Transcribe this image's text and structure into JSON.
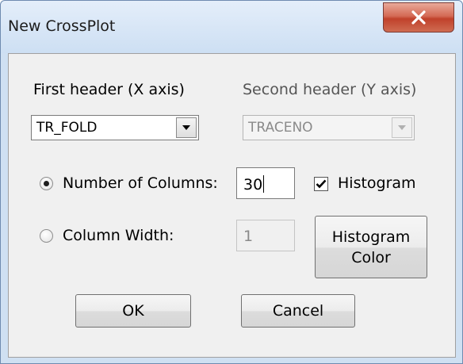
{
  "window": {
    "title": "New CrossPlot",
    "close_icon": "close-x-icon"
  },
  "x_header": {
    "label": "First header (X axis)",
    "value": "TR_FOLD"
  },
  "y_header": {
    "label": "Second header (Y axis)",
    "value": "TRACENO",
    "enabled": false
  },
  "mode": {
    "num_columns_label": "Number of Columns:",
    "num_columns_value": "30",
    "column_width_label": "Column Width:",
    "column_width_value": "1",
    "selected": "number_of_columns"
  },
  "histogram": {
    "label": "Histogram",
    "checked": true
  },
  "buttons": {
    "histogram_color_line1": "Histogram",
    "histogram_color_line2": "Color",
    "ok": "OK",
    "cancel": "Cancel"
  },
  "colors": {
    "close_button": "#c9452f",
    "frame": "#cfe0f2",
    "dialog_bg": "#f0f0f0"
  }
}
